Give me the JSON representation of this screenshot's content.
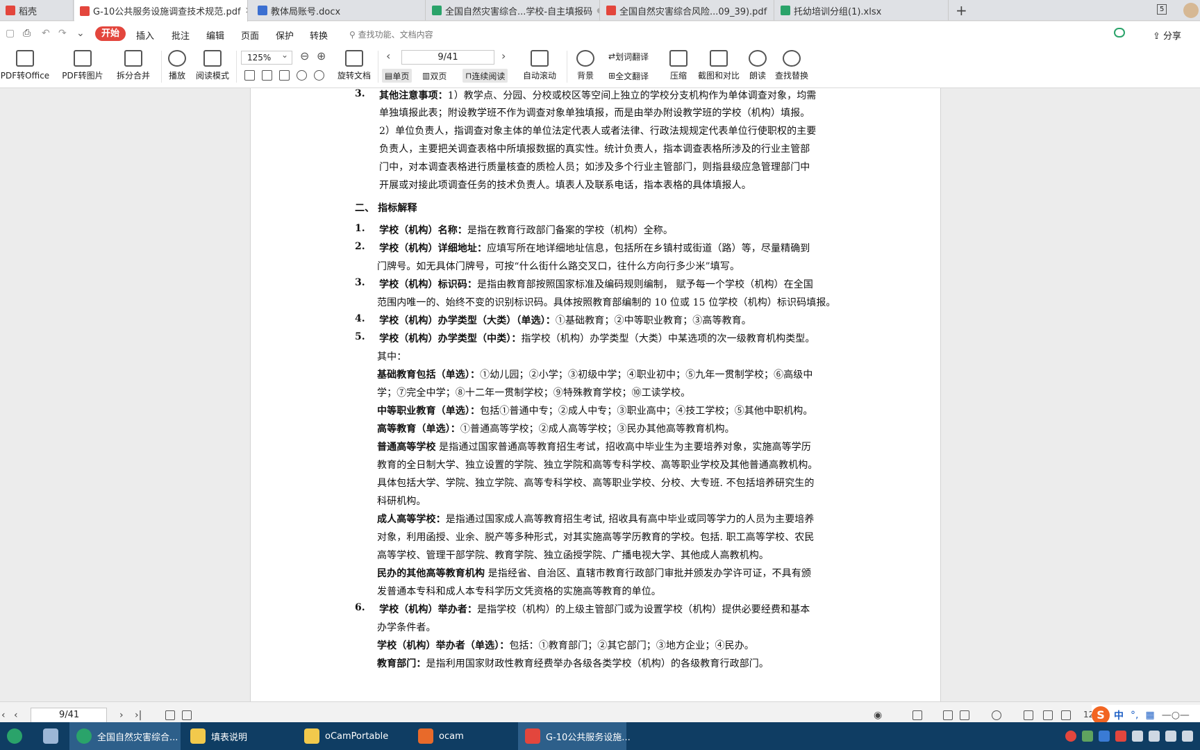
{
  "tabs": [
    {
      "label": "稻壳",
      "color": "#e3463d",
      "active": false
    },
    {
      "label": "G-10公共服务设施调查技术规范.pdf",
      "color": "#e3463d",
      "active": true,
      "close": "×"
    },
    {
      "label": "教体局账号.docx",
      "color": "#3b6fd1",
      "active": false
    },
    {
      "label": "全国自然灾害综合...学校-自主填报码",
      "color": "#2aa36a",
      "active": false,
      "dot": "●"
    },
    {
      "label": "全国自然灾害综合风险...09_39).pdf",
      "color": "#e3463d",
      "active": false
    },
    {
      "label": "托幼培训分组(1).xlsx",
      "color": "#2aa36a",
      "active": false
    }
  ],
  "tabbar": {
    "new_tab": "+",
    "tab_count": "5"
  },
  "menubar": {
    "start": "开始",
    "items": [
      "插入",
      "批注",
      "编辑",
      "页面",
      "保护",
      "转换"
    ],
    "search": "查找功能、文档内容",
    "share": "分享"
  },
  "ribbon": {
    "pdf_to_office": "PDF转Office",
    "pdf_to_image": "PDF转图片",
    "split_merge": "拆分合并",
    "play": "播放",
    "read_mode": "阅读模式",
    "zoom": "125%",
    "page": "9/41",
    "rotate": "旋转文档",
    "single": "单页",
    "double": "双页",
    "continuous": "连续阅读",
    "auto_scroll": "自动滚动",
    "background": "背景",
    "word_translate": "划词翻译",
    "full_translate": "全文翻译",
    "compress": "压缩",
    "screenshot": "截图和对比",
    "read_aloud": "朗读",
    "find_replace": "查找替换"
  },
  "doc": {
    "n3": "3.",
    "l1_bold": "其他注意事项：",
    "l1": "1）教学点、分园、分校或校区等空间上独立的学校分支机构作为单体调查对象，均需",
    "l2": "单独填报此表；附设教学班不作为调查对象单独填报，而是由举办附设教学班的学校（机构）填报。",
    "l3": "2）单位负责人，指调查对象主体的单位法定代表人或者法律、行政法规规定代表单位行使职权的主要",
    "l4": "负责人，主要把关调查表格中所填报数据的真实性。统计负责人，指本调查表格所涉及的行业主管部",
    "l5": "门中，对本调查表格进行质量核查的质检人员；如涉及多个行业主管部门，则指县级应急管理部门中",
    "l6": "开展或对接此项调查任务的技术负责人。填表人及联系电话，指本表格的具体填报人。",
    "section": "二、 指标解释",
    "i1_num": "1.",
    "i1_bold": "学校（机构）名称：",
    "i1": "是指在教育行政部门备案的学校（机构）全称。",
    "i2_num": "2.",
    "i2_bold": "学校（机构）详细地址：",
    "i2a": "应填写所在地详细地址信息，包括所在乡镇村或街道（路）等，尽量精确到",
    "i2b": "门牌号。如无具体门牌号，可按“什么街什么路交叉口，往什么方向行多少米”填写。",
    "i3_num": "3.",
    "i3_bold": "学校（机构）标识码：",
    "i3a": "是指由教育部按照国家标准及编码规则编制， 赋予每一个学校（机构）在全国",
    "i3b": "范围内唯一的、始终不变的识别标识码。具体按照教育部编制的 10 位或 15 位学校（机构）标识码填报。",
    "i4_num": "4.",
    "i4_bold": "学校（机构）办学类型（大类）（单选）：",
    "i4": "①基础教育；②中等职业教育；③高等教育。",
    "i5_num": "5.",
    "i5_bold": "学校（机构）办学类型（中类）：",
    "i5a": "指学校（机构）办学类型（大类）中某选项的次一级教育机构类型。",
    "i5b": "其中：",
    "basic_bold": "基础教育包括（单选）：",
    "basic_a": "①幼儿园；②小学；③初级中学；④职业初中；⑤九年一贯制学校；⑥高级中",
    "basic_b": "学；⑦完全中学；⑧十二年一贯制学校；⑨特殊教育学校；⑩工读学校。",
    "voc_bold": "中等职业教育（单选）：",
    "voc": "包括①普通中专；②成人中专；③职业高中；④技工学校；⑤其他中职机构。",
    "higher_bold": "高等教育（单选）：",
    "higher": "①普通高等学校；②成人高等学校；③民办其他高等教育机构。",
    "reg_bold": "普通高等学校",
    "reg_a": " 是指通过国家普通高等教育招生考试，招收高中毕业生为主要培养对象，实施高等学历",
    "reg_b": "教育的全日制大学、独立设置的学院、独立学院和高等专科学校、高等职业学校及其他普通高教机构。",
    "reg_c": "具体包括大学、学院、独立学院、高等专科学校、高等职业学校、分校、大专班. 不包括培养研究生的",
    "reg_d": "科研机构。",
    "adult_bold": "成人高等学校：",
    "adult_a": "是指通过国家成人高等教育招生考试, 招收具有高中毕业或同等学力的人员为主要培养",
    "adult_b": "对象，利用函授、业余、脱产等多种形式，对其实施高等学历教育的学校。包括. 职工高等学校、农民",
    "adult_c": "高等学校、管理干部学院、教育学院、独立函授学院、广播电视大学、其他成人高教机构。",
    "priv_bold": "民办的其他高等教育机构",
    "priv_a": " 是指经省、自治区、直辖市教育行政部门审批并颁发办学许可证，不具有颁",
    "priv_b": "发普通本专科和成人本专科学历文凭资格的实施高等教育的单位。",
    "i6_num": "6.",
    "i6_bold": "学校（机构）举办者：",
    "i6a": "是指学校（机构）的上级主管部门或为设置学校（机构）提供必要经费和基本",
    "i6b": "办学条件者。",
    "sponsor_bold": "学校（机构）举办者（单选）：",
    "sponsor": "包括：①教育部门；②其它部门；③地方企业；④民办。",
    "edu_bold": "教育部门：",
    "edu": "是指利用国家财政性教育经费举办各级各类学校（机构）的各级教育行政部门。"
  },
  "statusbar": {
    "page": "9/41",
    "zoom": "125%",
    "ime_logo": "S",
    "ime_lang": "中"
  },
  "taskbar": [
    {
      "label": "全国自然灾害综合...",
      "color": "#2aa36a",
      "active": true
    },
    {
      "label": "填表说明",
      "color": "#f2c94c",
      "active": false
    },
    {
      "label": "oCamPortable",
      "color": "#f2c94c",
      "active": false
    },
    {
      "label": "ocam",
      "color": "#e86a2a",
      "active": false
    },
    {
      "label": "G-10公共服务设施...",
      "color": "#e3463d",
      "active": true
    }
  ]
}
